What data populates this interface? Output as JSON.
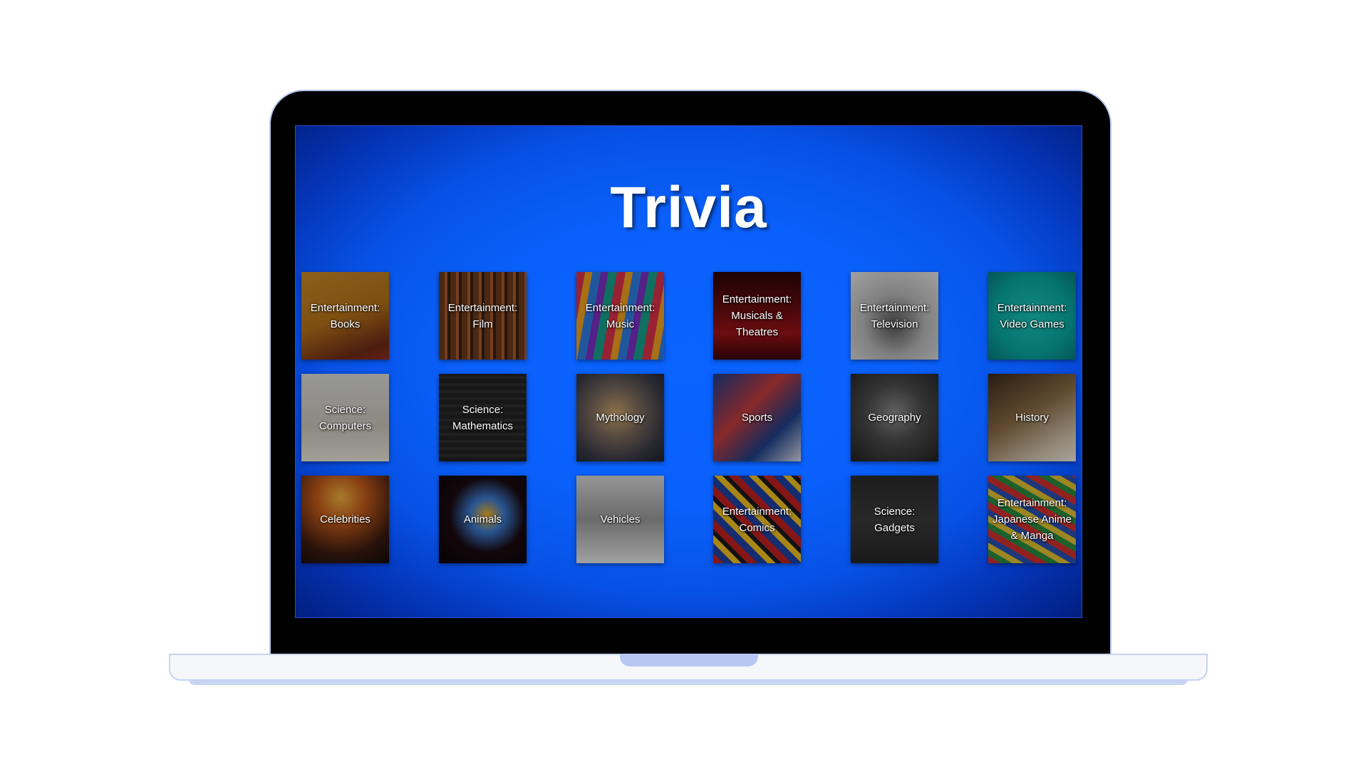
{
  "app": {
    "title": "Trivia"
  },
  "categories": [
    {
      "label": "Entertainment: Books",
      "art": "books-stack-image"
    },
    {
      "label": "Entertainment: Film",
      "art": "film-projector-image"
    },
    {
      "label": "Entertainment: Music",
      "art": "music-pattern-image"
    },
    {
      "label": "Entertainment: Musicals & Theatres",
      "art": "theatre-seats-image"
    },
    {
      "label": "Entertainment: Television",
      "art": "retro-tv-image"
    },
    {
      "label": "Entertainment: Video Games",
      "art": "game-controllers-image"
    },
    {
      "label": "Science: Computers",
      "art": "retro-computer-image"
    },
    {
      "label": "Science: Mathematics",
      "art": "chalkboard-equations-image"
    },
    {
      "label": "Mythology",
      "art": "mythology-painting-image"
    },
    {
      "label": "Sports",
      "art": "sports-balls-image"
    },
    {
      "label": "Geography",
      "art": "compass-image"
    },
    {
      "label": "History",
      "art": "old-books-image"
    },
    {
      "label": "Celebrities",
      "art": "concert-crowd-image"
    },
    {
      "label": "Animals",
      "art": "parrot-image"
    },
    {
      "label": "Vehicles",
      "art": "classic-car-image"
    },
    {
      "label": "Entertainment: Comics",
      "art": "comic-characters-image"
    },
    {
      "label": "Science: Gadgets",
      "art": "gadgets-flatlay-image"
    },
    {
      "label": "Entertainment: Japanese Anime & Manga",
      "art": "manga-collage-image"
    }
  ],
  "colors": {
    "screen_center": "#0a63ff",
    "screen_edge": "#021e80",
    "title_text": "#ffffff"
  }
}
